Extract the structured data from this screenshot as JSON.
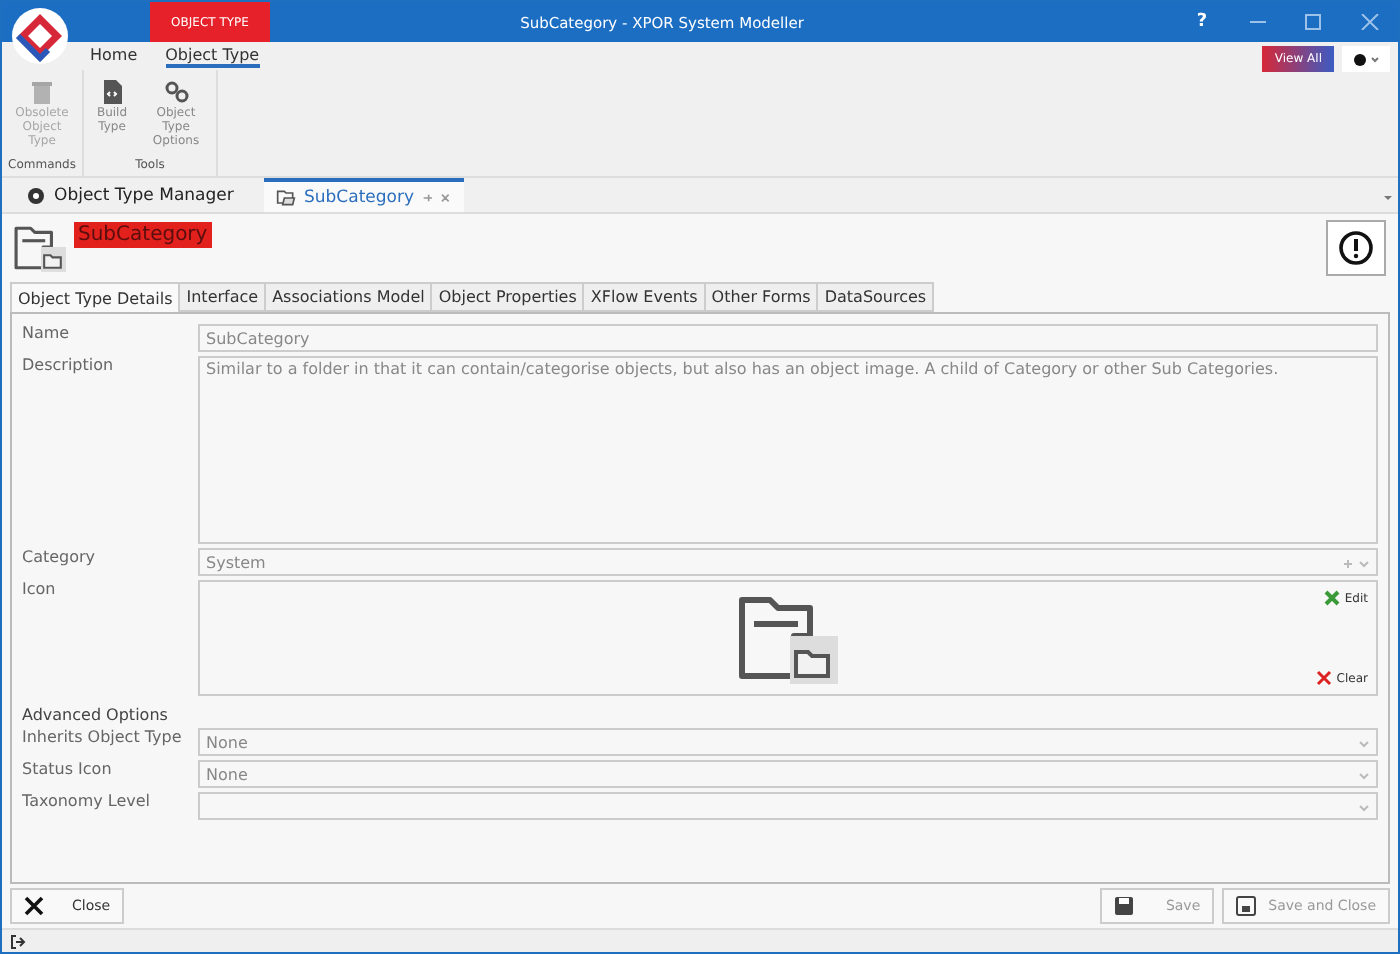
{
  "window": {
    "context_tab": "OBJECT TYPE",
    "title": "SubCategory - XPOR System Modeller",
    "help": "?"
  },
  "ribbon": {
    "tabs": [
      {
        "label": "Home",
        "selected": false
      },
      {
        "label": "Object Type",
        "selected": true
      }
    ],
    "groups": [
      {
        "label": "Commands",
        "buttons": [
          {
            "label": "Obsolete Object Type",
            "kind": "trash",
            "disabled": true
          }
        ]
      },
      {
        "label": "Tools",
        "buttons": [
          {
            "label": "Build Type",
            "kind": "build",
            "disabled": false
          },
          {
            "label": "Object Type Options",
            "kind": "gears",
            "disabled": false
          }
        ]
      }
    ],
    "view_all": "View All"
  },
  "documents": [
    {
      "label": "Object Type Manager",
      "kind": "manager",
      "selected": false,
      "closable": false
    },
    {
      "label": "SubCategory",
      "kind": "folder",
      "selected": true,
      "closable": true
    }
  ],
  "header": {
    "title": "SubCategory"
  },
  "tabs": [
    {
      "label": "Object Type Details",
      "selected": true
    },
    {
      "label": "Interface",
      "selected": false
    },
    {
      "label": "Associations Model",
      "selected": false
    },
    {
      "label": "Object Properties",
      "selected": false
    },
    {
      "label": "XFlow Events",
      "selected": false
    },
    {
      "label": "Other Forms",
      "selected": false
    },
    {
      "label": "DataSources",
      "selected": false
    }
  ],
  "form": {
    "name": {
      "label": "Name",
      "value": "SubCategory"
    },
    "description": {
      "label": "Description",
      "value": "Similar to a folder in that it can contain/categorise objects, but also has an object image. A child of Category or other Sub Categories."
    },
    "category": {
      "label": "Category",
      "value": "System"
    },
    "icon": {
      "label": "Icon",
      "edit": "Edit",
      "clear": "Clear"
    },
    "advanced_title": "Advanced Options",
    "advanced": [
      {
        "label": "Inherits Object Type",
        "value": "None"
      },
      {
        "label": "Status Icon",
        "value": "None"
      },
      {
        "label": "Taxonomy Level"
      }
    ]
  },
  "footer": [
    {
      "label": "Close",
      "kind": "close",
      "disabled": false
    },
    {
      "label": "Save",
      "kind": "save",
      "disabled": true
    },
    {
      "label": "Save and Close",
      "kind": "saveclose",
      "disabled": true
    }
  ]
}
